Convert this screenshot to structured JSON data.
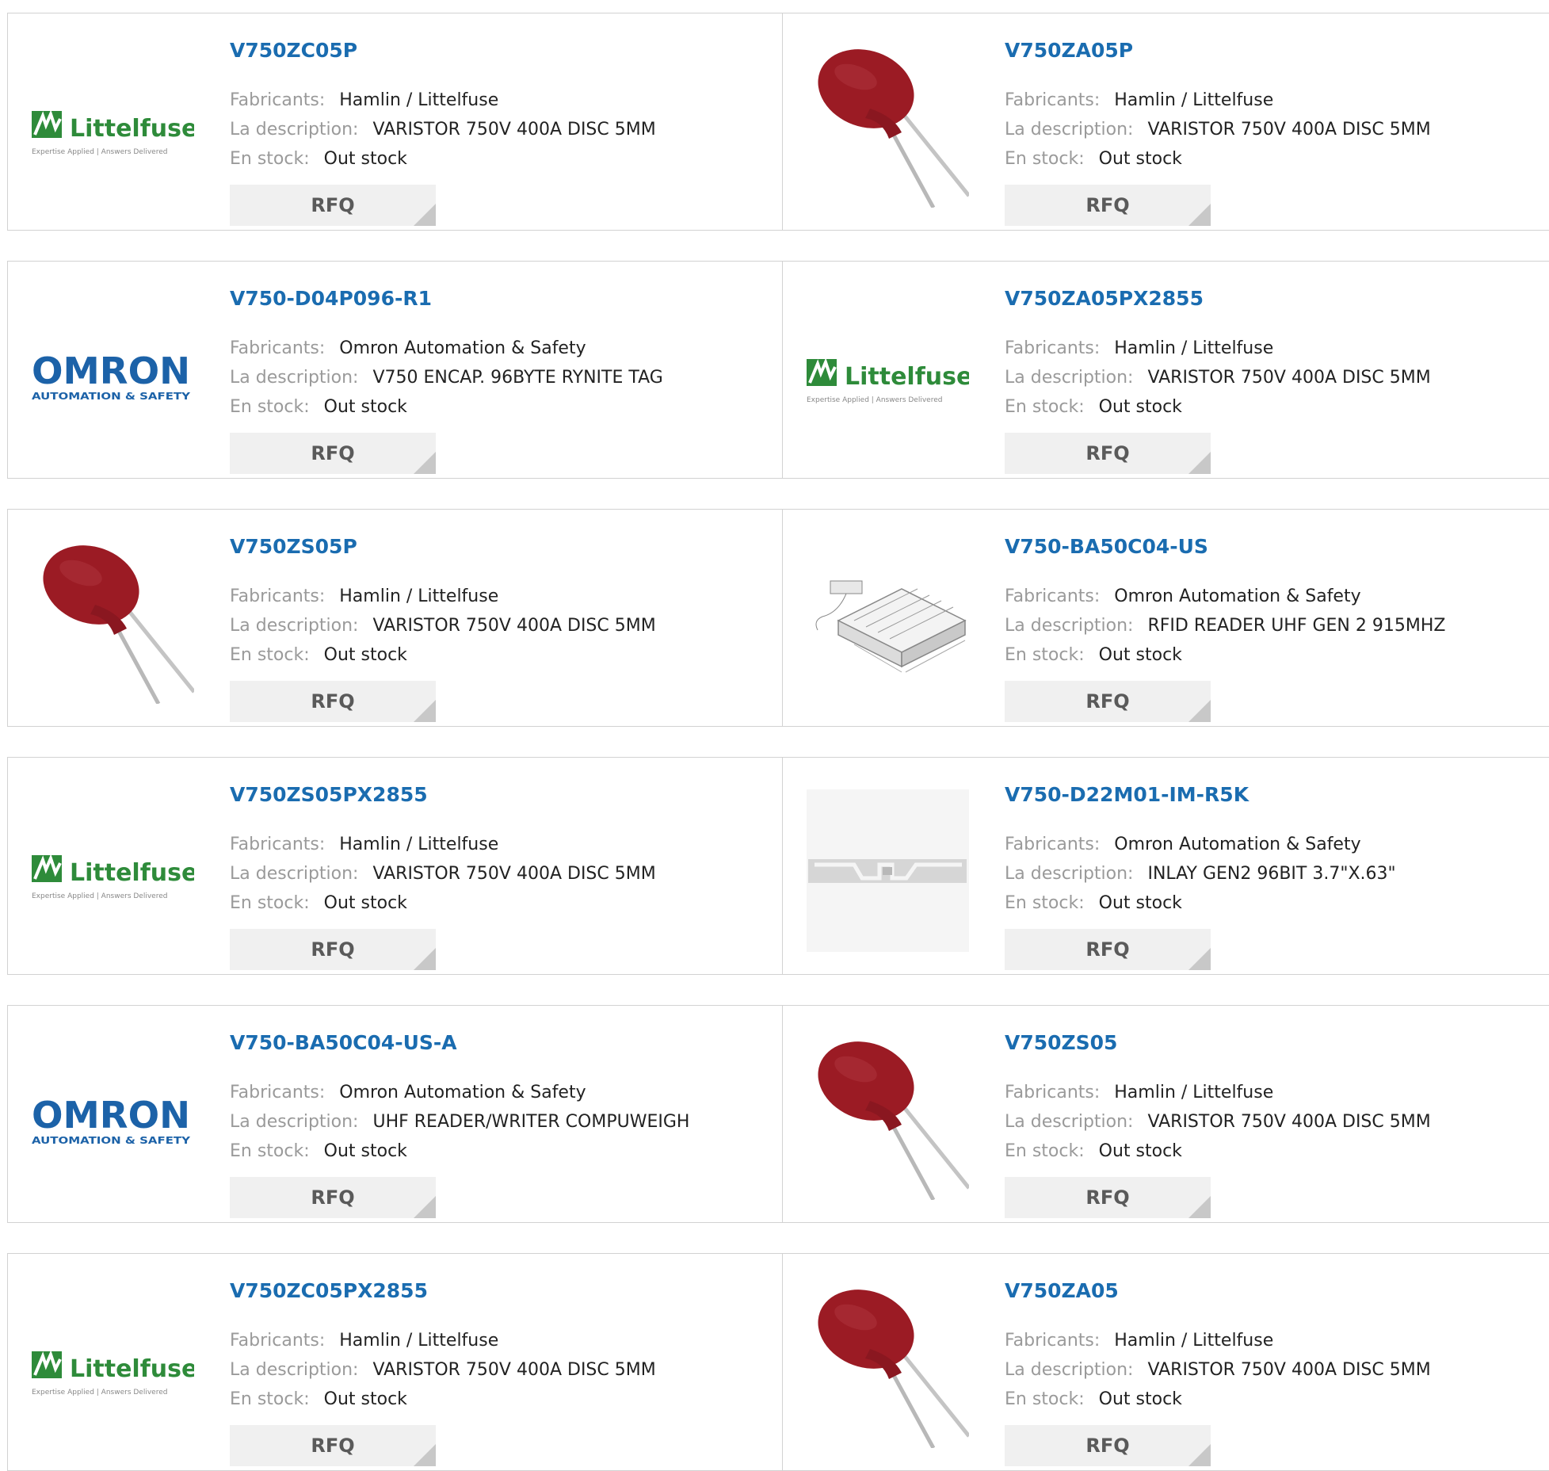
{
  "labels": {
    "manufacturer": "Fabricants:",
    "description": "La description:",
    "stock": "En stock:",
    "rfq": "RFQ"
  },
  "logos": {
    "littelfuse_name": "Littelfuse",
    "littelfuse_tagline": "Expertise Applied | Answers Delivered",
    "omron_name": "OMRON",
    "omron_tagline": "AUTOMATION & SAFETY"
  },
  "products": [
    {
      "part": "V750ZC05P",
      "manufacturer": "Hamlin / Littelfuse",
      "description": "VARISTOR 750V 400A DISC 5MM",
      "stock": "Out stock",
      "image": "littelfuse-logo"
    },
    {
      "part": "V750ZA05P",
      "manufacturer": "Hamlin / Littelfuse",
      "description": "VARISTOR 750V 400A DISC 5MM",
      "stock": "Out stock",
      "image": "varistor-photo"
    },
    {
      "part": "V750-D04P096-R1",
      "manufacturer": "Omron Automation & Safety",
      "description": "V750 ENCAP. 96BYTE RYNITE TAG",
      "stock": "Out stock",
      "image": "omron-logo"
    },
    {
      "part": "V750ZA05PX2855",
      "manufacturer": "Hamlin / Littelfuse",
      "description": "VARISTOR 750V 400A DISC 5MM",
      "stock": "Out stock",
      "image": "littelfuse-logo"
    },
    {
      "part": "V750ZS05P",
      "manufacturer": "Hamlin / Littelfuse",
      "description": "VARISTOR 750V 400A DISC 5MM",
      "stock": "Out stock",
      "image": "varistor-photo"
    },
    {
      "part": "V750-BA50C04-US",
      "manufacturer": "Omron Automation & Safety",
      "description": "RFID READER UHF GEN 2 915MHZ",
      "stock": "Out stock",
      "image": "rfid-reader-drawing"
    },
    {
      "part": "V750ZS05PX2855",
      "manufacturer": "Hamlin / Littelfuse",
      "description": "VARISTOR 750V 400A DISC 5MM",
      "stock": "Out stock",
      "image": "littelfuse-logo"
    },
    {
      "part": "V750-D22M01-IM-R5K",
      "manufacturer": "Omron Automation & Safety",
      "description": "INLAY GEN2 96BIT 3.7\"X.63\"",
      "stock": "Out stock",
      "image": "rfid-inlay-photo"
    },
    {
      "part": "V750-BA50C04-US-A",
      "manufacturer": "Omron Automation & Safety",
      "description": "UHF READER/WRITER COMPUWEIGH",
      "stock": "Out stock",
      "image": "omron-logo"
    },
    {
      "part": "V750ZS05",
      "manufacturer": "Hamlin / Littelfuse",
      "description": "VARISTOR 750V 400A DISC 5MM",
      "stock": "Out stock",
      "image": "varistor-photo"
    },
    {
      "part": "V750ZC05PX2855",
      "manufacturer": "Hamlin / Littelfuse",
      "description": "VARISTOR 750V 400A DISC 5MM",
      "stock": "Out stock",
      "image": "littelfuse-logo"
    },
    {
      "part": "V750ZA05",
      "manufacturer": "Hamlin / Littelfuse",
      "description": "VARISTOR 750V 400A DISC 5MM",
      "stock": "Out stock",
      "image": "varistor-photo"
    }
  ],
  "colors": {
    "part_link": "#1a6cb0",
    "label": "#9a9a9a",
    "rfq_bg": "#f0f0f0",
    "varistor": "#9b1b24",
    "littelfuse_green": "#2e8b3a",
    "omron_blue": "#1c62a8"
  }
}
